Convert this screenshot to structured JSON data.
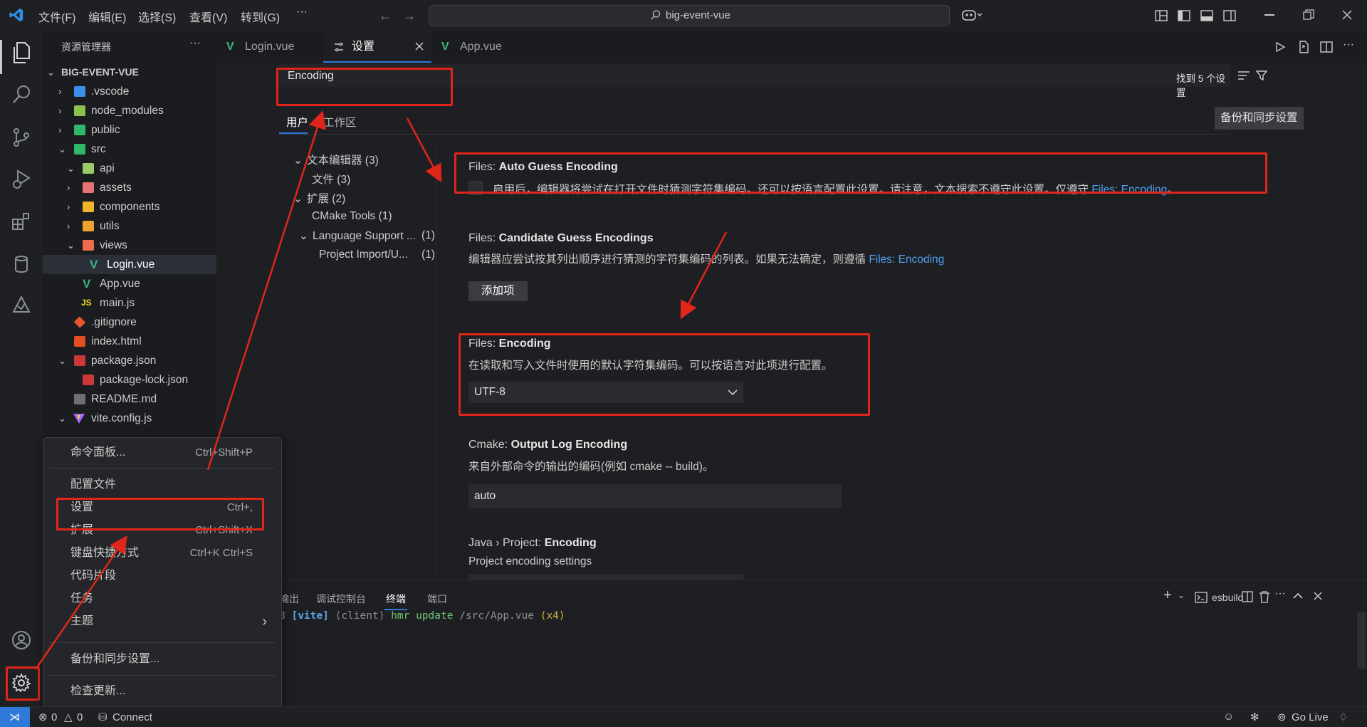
{
  "titlebar": {
    "menus": [
      "文件(F)",
      "编辑(E)",
      "选择(S)",
      "查看(V)",
      "转到(G)",
      "···"
    ],
    "search_text": "big-event-vue"
  },
  "explorer": {
    "header": "资源管理器",
    "more": "···",
    "project": "BIG-EVENT-VUE",
    "items": [
      {
        "label": ".vscode"
      },
      {
        "label": "node_modules"
      },
      {
        "label": "public"
      },
      {
        "label": "src"
      },
      {
        "label": "api"
      },
      {
        "label": "assets"
      },
      {
        "label": "components"
      },
      {
        "label": "utils"
      },
      {
        "label": "views"
      },
      {
        "label": "Login.vue"
      },
      {
        "label": "App.vue"
      },
      {
        "label": "main.js"
      },
      {
        "label": ".gitignore"
      },
      {
        "label": "index.html"
      },
      {
        "label": "package.json"
      },
      {
        "label": "package-lock.json"
      },
      {
        "label": "README.md"
      },
      {
        "label": "vite.config.js"
      }
    ]
  },
  "tabs": [
    {
      "label": "Login.vue"
    },
    {
      "label": "设置"
    },
    {
      "label": "App.vue"
    }
  ],
  "settings": {
    "search_value": "Encoding",
    "found": "找到 5 个设置",
    "scope_user": "用户",
    "scope_workspace": "工作区",
    "backup_button": "备份和同步设置",
    "toc": [
      {
        "label": "文本编辑器 (3)"
      },
      {
        "label": "文件 (3)"
      },
      {
        "label": "扩展 (2)"
      },
      {
        "label": "CMake Tools (1)"
      },
      {
        "label": "Language Support ...",
        "count": "(1)"
      },
      {
        "label": "Project Import/U...",
        "count": "(1)"
      }
    ],
    "s1": {
      "prefix": "Files: ",
      "name": "Auto Guess Encoding",
      "desc": "启用后，编辑器将尝试在打开文件时猜测字符集编码。还可以按语言配置此设置。请注意，文本搜索不遵守此设置。仅遵守 ",
      "link": "Files: Encoding",
      "tail": "。"
    },
    "s2": {
      "prefix": "Files: ",
      "name": "Candidate Guess Encodings",
      "desc": "编辑器应尝试按其列出顺序进行猜测的字符集编码的列表。如果无法确定，则遵循 ",
      "link": "Files: Encoding",
      "button": "添加项"
    },
    "s3": {
      "prefix": "Files: ",
      "name": "Encoding",
      "desc": "在读取和写入文件时使用的默认字符集编码。可以按语言对此项进行配置。",
      "value": "UTF-8"
    },
    "s4": {
      "prefix": "Cmake: ",
      "name": "Output Log Encoding",
      "desc": "来自外部命令的输出的编码(例如 cmake -- build)。",
      "value": "auto"
    },
    "s5": {
      "prefix": "Java › Project: ",
      "name": "Encoding",
      "desc": "Project encoding settings"
    }
  },
  "panel": {
    "tabs": [
      "输出",
      "调试控制台",
      "终端",
      "端口"
    ],
    "terminal_name": "esbuild",
    "log": {
      "num": "8",
      "vite": "[vite]",
      "client": "(client)",
      "msg": "hmr update",
      "path": "/src/App.vue",
      "count": "(x4)"
    }
  },
  "context_menu": {
    "items": [
      {
        "label": "命令面板...",
        "kb": "Ctrl+Shift+P"
      },
      {
        "label": "配置文件",
        "kb": ""
      },
      {
        "label": "设置",
        "kb": "Ctrl+,"
      },
      {
        "label": "扩展",
        "kb": "Ctrl+Shift+X"
      },
      {
        "label": "键盘快捷方式",
        "kb": "Ctrl+K Ctrl+S"
      },
      {
        "label": "代码片段",
        "kb": ""
      },
      {
        "label": "任务",
        "kb": ""
      },
      {
        "label": "主题",
        "kb": "›"
      },
      {
        "label": "备份和同步设置...",
        "kb": ""
      },
      {
        "label": "检查更新...",
        "kb": ""
      }
    ]
  },
  "status": {
    "errors": "0",
    "warnings": "0",
    "connect": "Connect",
    "golive": "Go Live"
  },
  "colors": {
    "accent_blue": "#2f7ad8",
    "annotation_red": "#e0261b",
    "link": "#4ea1f3"
  }
}
